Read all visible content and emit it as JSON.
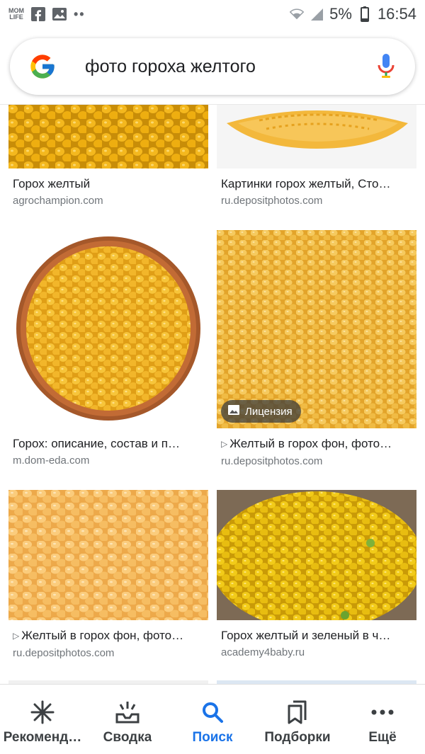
{
  "status_bar": {
    "app_badge": "MOM LIFE",
    "icons": [
      "momlife-icon",
      "facebook-icon",
      "gallery-icon",
      "more-dots-icon",
      "wifi-icon",
      "signal-icon",
      "battery-icon"
    ],
    "dots": "••",
    "battery_percent": "5%",
    "time": "16:54"
  },
  "search": {
    "query": "фото гороха желтого",
    "logo_icon": "google-g-icon",
    "mic_icon": "microphone-icon"
  },
  "results": [
    {
      "title": "Горох желтый",
      "domain": "agrochampion.com",
      "has_play": false,
      "license": ""
    },
    {
      "title": "Картинки горох желтый, Сто…",
      "domain": "ru.depositphotos.com",
      "has_play": false,
      "license": ""
    },
    {
      "title": "Горох: описание, состав и п…",
      "domain": "m.dom-eda.com",
      "has_play": false,
      "license": ""
    },
    {
      "title": "Желтый в горох фон, фото…",
      "domain": "ru.depositphotos.com",
      "has_play": true,
      "license": "Лицензия"
    },
    {
      "title": "Желтый в горох фон, фото…",
      "domain": "ru.depositphotos.com",
      "has_play": true,
      "license": ""
    },
    {
      "title": "Горох желтый и зеленый в ч…",
      "domain": "academy4baby.ru",
      "has_play": false,
      "license": ""
    }
  ],
  "bottom_nav": [
    {
      "label": "Рекоменд…",
      "icon": "asterisk-icon",
      "active": false
    },
    {
      "label": "Сводка",
      "icon": "inbox-updates-icon",
      "active": false
    },
    {
      "label": "Поиск",
      "icon": "search-icon",
      "active": true
    },
    {
      "label": "Подборки",
      "icon": "collections-icon",
      "active": false
    },
    {
      "label": "Ещё",
      "icon": "more-horizontal-icon",
      "active": false
    }
  ],
  "colors": {
    "accent": "#1a73e8",
    "text": "#202124",
    "secondary_text": "#70757a",
    "pea_yellow": "#f2b51c"
  }
}
